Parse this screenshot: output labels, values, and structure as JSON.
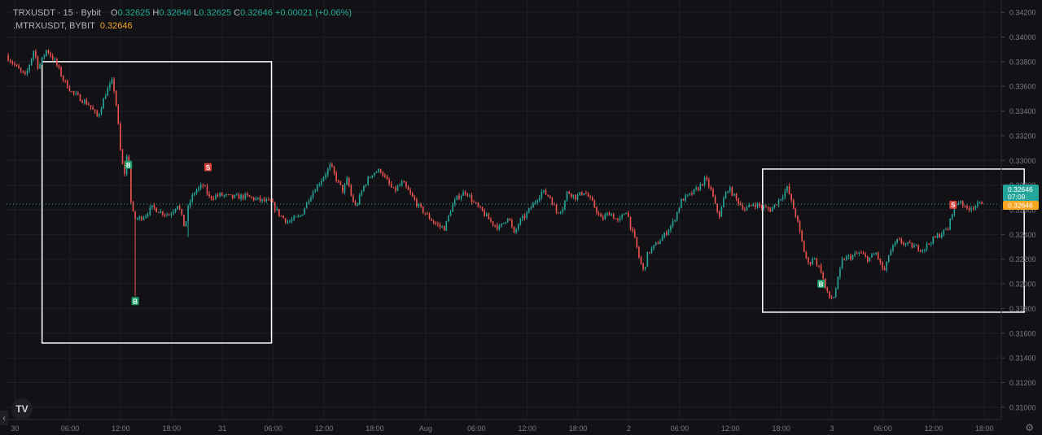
{
  "legend": {
    "symbol": "TRXUSDT · 15 · Bybit",
    "o_label": "O",
    "o": "0.32625",
    "h_label": "H",
    "h": "0.32646",
    "l_label": "L",
    "l": "0.32625",
    "c_label": "C",
    "c": "0.32646",
    "change": "+0.00021 (+0.06%)",
    "indicator_name": ".MTRXUSDT, BYBIT",
    "indicator_value": "0.32646"
  },
  "price_tags": {
    "last_price": "0.32646",
    "countdown": "07:09",
    "mark_price": "0.32646"
  },
  "colors": {
    "background": "#121216",
    "grid": "#1e1f25",
    "up": "#26a69a",
    "down": "#ef5350",
    "axis_text": "#787b86",
    "box": "#ffffff",
    "last_price_tag": "#26a69a",
    "mark_price_tag": "#f5a623"
  },
  "logo_text": "TV",
  "collapse_icon": "‹",
  "settings_icon": "⚙",
  "chart_data": {
    "type": "candlestick",
    "y_axis": {
      "min": 0.309,
      "max": 0.343,
      "position": "right",
      "ticks": [
        "0.34200",
        "0.34000",
        "0.33800",
        "0.33600",
        "0.33400",
        "0.33200",
        "0.33000",
        "0.32800",
        "0.32600",
        "0.32400",
        "0.32200",
        "0.32000",
        "0.31800",
        "0.31600",
        "0.31400",
        "0.31200",
        "0.31000"
      ]
    },
    "x_axis": {
      "ticks": [
        {
          "label": "30",
          "t": 0.0
        },
        {
          "label": "06:00",
          "t": 6.5
        },
        {
          "label": "12:00",
          "t": 12.5
        },
        {
          "label": "18:00",
          "t": 18.5
        },
        {
          "label": "31",
          "t": 24.5
        },
        {
          "label": "06:00",
          "t": 30.5
        },
        {
          "label": "12:00",
          "t": 36.5
        },
        {
          "label": "18:00",
          "t": 42.5
        },
        {
          "label": "Aug",
          "t": 48.5
        },
        {
          "label": "06:00",
          "t": 54.5
        },
        {
          "label": "12:00",
          "t": 60.5
        },
        {
          "label": "18:00",
          "t": 66.5
        },
        {
          "label": "2",
          "t": 72.5
        },
        {
          "label": "06:00",
          "t": 78.5
        },
        {
          "label": "12:00",
          "t": 84.5
        },
        {
          "label": "18:00",
          "t": 90.5
        },
        {
          "label": "3",
          "t": 96.5
        },
        {
          "label": "06:00",
          "t": 102.5
        },
        {
          "label": "12:00",
          "t": 108.5
        },
        {
          "label": "18:00",
          "t": 114.5
        }
      ],
      "t_min": -1.0,
      "t_max": 116.3
    },
    "current_price": 0.32646,
    "waypoints": [
      [
        -0.8,
        0.3385
      ],
      [
        0.5,
        0.3375
      ],
      [
        1.5,
        0.3368
      ],
      [
        2.5,
        0.339
      ],
      [
        3.0,
        0.3375
      ],
      [
        4.0,
        0.339
      ],
      [
        5.0,
        0.338
      ],
      [
        6.0,
        0.3365
      ],
      [
        7.0,
        0.3355
      ],
      [
        8.0,
        0.335
      ],
      [
        9.0,
        0.3345
      ],
      [
        10.0,
        0.3335
      ],
      [
        11.0,
        0.3355
      ],
      [
        11.8,
        0.3365
      ],
      [
        12.3,
        0.334
      ],
      [
        12.8,
        0.33
      ],
      [
        13.2,
        0.329
      ],
      [
        13.6,
        0.331
      ],
      [
        14.0,
        0.326
      ],
      [
        14.5,
        0.3252
      ],
      [
        15.5,
        0.3255
      ],
      [
        16.5,
        0.3262
      ],
      [
        17.5,
        0.3258
      ],
      [
        18.5,
        0.3256
      ],
      [
        19.5,
        0.3265
      ],
      [
        20.3,
        0.3245
      ],
      [
        20.8,
        0.3265
      ],
      [
        21.5,
        0.3275
      ],
      [
        22.5,
        0.328
      ],
      [
        23.2,
        0.327
      ],
      [
        24.5,
        0.3272
      ],
      [
        26.0,
        0.327
      ],
      [
        27.5,
        0.3271
      ],
      [
        29.0,
        0.3268
      ],
      [
        30.5,
        0.3266
      ],
      [
        31.5,
        0.3256
      ],
      [
        32.5,
        0.325
      ],
      [
        34.0,
        0.3255
      ],
      [
        35.0,
        0.327
      ],
      [
        36.0,
        0.328
      ],
      [
        37.0,
        0.329
      ],
      [
        37.5,
        0.3296
      ],
      [
        38.2,
        0.3285
      ],
      [
        39.0,
        0.3275
      ],
      [
        39.5,
        0.3285
      ],
      [
        40.0,
        0.327
      ],
      [
        40.5,
        0.3262
      ],
      [
        41.5,
        0.328
      ],
      [
        42.5,
        0.329
      ],
      [
        43.5,
        0.3292
      ],
      [
        44.0,
        0.3285
      ],
      [
        45.0,
        0.3275
      ],
      [
        46.0,
        0.3282
      ],
      [
        47.0,
        0.3272
      ],
      [
        48.0,
        0.3262
      ],
      [
        49.0,
        0.3255
      ],
      [
        50.0,
        0.3248
      ],
      [
        51.0,
        0.3245
      ],
      [
        51.8,
        0.3262
      ],
      [
        52.5,
        0.327
      ],
      [
        53.5,
        0.3275
      ],
      [
        54.5,
        0.3265
      ],
      [
        55.5,
        0.3258
      ],
      [
        56.5,
        0.325
      ],
      [
        57.5,
        0.3245
      ],
      [
        58.5,
        0.3255
      ],
      [
        59.2,
        0.324
      ],
      [
        59.8,
        0.325
      ],
      [
        60.5,
        0.3255
      ],
      [
        61.5,
        0.3265
      ],
      [
        62.5,
        0.3275
      ],
      [
        63.5,
        0.327
      ],
      [
        64.2,
        0.3258
      ],
      [
        65.0,
        0.3262
      ],
      [
        65.5,
        0.3275
      ],
      [
        66.5,
        0.327
      ],
      [
        67.5,
        0.3275
      ],
      [
        68.5,
        0.3265
      ],
      [
        69.5,
        0.3252
      ],
      [
        70.5,
        0.3258
      ],
      [
        71.5,
        0.325
      ],
      [
        72.5,
        0.326
      ],
      [
        73.0,
        0.3245
      ],
      [
        73.5,
        0.3235
      ],
      [
        74.0,
        0.322
      ],
      [
        74.5,
        0.321
      ],
      [
        75.0,
        0.3225
      ],
      [
        76.0,
        0.3232
      ],
      [
        77.0,
        0.324
      ],
      [
        78.0,
        0.325
      ],
      [
        79.0,
        0.3268
      ],
      [
        80.0,
        0.3272
      ],
      [
        81.0,
        0.3278
      ],
      [
        81.8,
        0.3285
      ],
      [
        82.5,
        0.3275
      ],
      [
        83.0,
        0.3262
      ],
      [
        83.5,
        0.3255
      ],
      [
        84.0,
        0.327
      ],
      [
        84.5,
        0.3278
      ],
      [
        85.5,
        0.3268
      ],
      [
        86.5,
        0.326
      ],
      [
        87.5,
        0.3265
      ],
      [
        88.5,
        0.3262
      ],
      [
        89.5,
        0.326
      ],
      [
        90.5,
        0.3268
      ],
      [
        91.5,
        0.3278
      ],
      [
        92.0,
        0.3265
      ],
      [
        92.5,
        0.3255
      ],
      [
        93.0,
        0.324
      ],
      [
        93.5,
        0.3225
      ],
      [
        94.0,
        0.3215
      ],
      [
        94.5,
        0.3222
      ],
      [
        95.5,
        0.321
      ],
      [
        96.0,
        0.3195
      ],
      [
        96.5,
        0.3188
      ],
      [
        97.0,
        0.319
      ],
      [
        97.5,
        0.3205
      ],
      [
        98.0,
        0.322
      ],
      [
        99.0,
        0.3222
      ],
      [
        100.0,
        0.3225
      ],
      [
        101.0,
        0.322
      ],
      [
        102.0,
        0.3225
      ],
      [
        102.5,
        0.3215
      ],
      [
        103.0,
        0.321
      ],
      [
        103.5,
        0.3225
      ],
      [
        104.5,
        0.3235
      ],
      [
        105.5,
        0.3232
      ],
      [
        106.5,
        0.323
      ],
      [
        107.5,
        0.3228
      ],
      [
        108.5,
        0.3235
      ],
      [
        109.5,
        0.324
      ],
      [
        110.5,
        0.3245
      ],
      [
        111.0,
        0.326
      ],
      [
        111.5,
        0.3265
      ],
      [
        112.0,
        0.3268
      ],
      [
        112.5,
        0.326
      ],
      [
        113.0,
        0.3262
      ],
      [
        113.5,
        0.3263
      ],
      [
        114.0,
        0.3264
      ],
      [
        114.3,
        0.32646
      ]
    ],
    "spikes": [
      {
        "t": 14.15,
        "low": 0.319
      },
      {
        "t": 20.4,
        "low": 0.3238
      }
    ],
    "boxes": [
      {
        "t1": 3.2,
        "t2": 30.3,
        "p_top": 0.338,
        "p_bottom": 0.3152
      },
      {
        "t1": 88.3,
        "t2": 119.2,
        "p_top": 0.3293,
        "p_bottom": 0.3177
      }
    ],
    "markers": [
      {
        "label": "B",
        "t": 13.4,
        "price": 0.32965,
        "kind": "buy"
      },
      {
        "label": "B",
        "t": 14.2,
        "price": 0.3186,
        "kind": "buy"
      },
      {
        "label": "S",
        "t": 22.8,
        "price": 0.32945,
        "kind": "sell"
      },
      {
        "label": "B",
        "t": 95.2,
        "price": 0.32,
        "kind": "buy"
      },
      {
        "label": "S",
        "t": 110.8,
        "price": 0.3264,
        "kind": "sell"
      }
    ]
  }
}
